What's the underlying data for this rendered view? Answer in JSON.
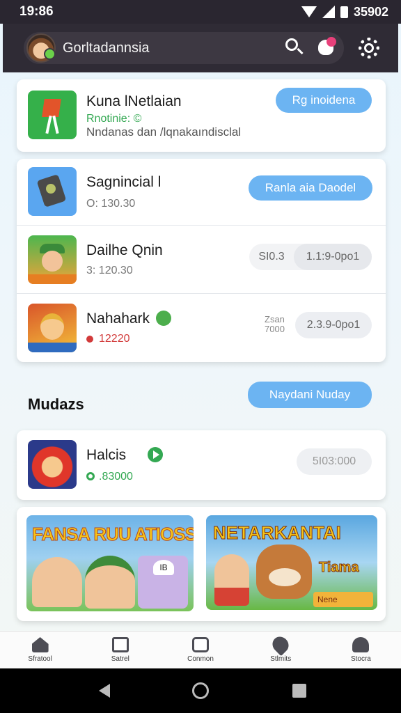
{
  "status_bar": {
    "time": "19:86",
    "battery_text": "35902"
  },
  "app_bar": {
    "title": "Gorltadannsia"
  },
  "featured": {
    "name": "Kuna lNetlaian",
    "subtitle": "Rnotinie: ©",
    "description": "Nndanas dan /lqnakaındisclal",
    "button": "Rg inoidena"
  },
  "list_items": [
    {
      "name": "Sagnincial l",
      "meta": "O: 130.30",
      "button": "Ranla aia Daodel"
    },
    {
      "name": "Dailhe Qnin",
      "meta": "3: 120.30",
      "left_label": "SI0.3",
      "button": "1.1:9-0po1"
    },
    {
      "name": "Nahahark",
      "meta": "12220",
      "left_label_1": "Zsan",
      "left_label_2": "7000",
      "button": "2.3.9-0po1"
    }
  ],
  "section": {
    "title": "Mudazs",
    "button": "Naydani Nuday"
  },
  "halcis": {
    "name": "Halcis",
    "meta": ".83000",
    "button": "5I03:000"
  },
  "banners": [
    {
      "title": "FANSA RUU ATIOSS",
      "badge": "IB"
    },
    {
      "title": "NETARKANTAI",
      "subtitle": "Tiama",
      "tag": "Nene"
    }
  ],
  "bottom_nav": [
    "Sfratool",
    "Satrel",
    "Conmon",
    "Stlmits",
    "Stocra"
  ],
  "colors": {
    "accent_blue": "#6cb4f2",
    "appbar": "#2f2b35",
    "green": "#33a852",
    "red": "#d23a3a"
  }
}
